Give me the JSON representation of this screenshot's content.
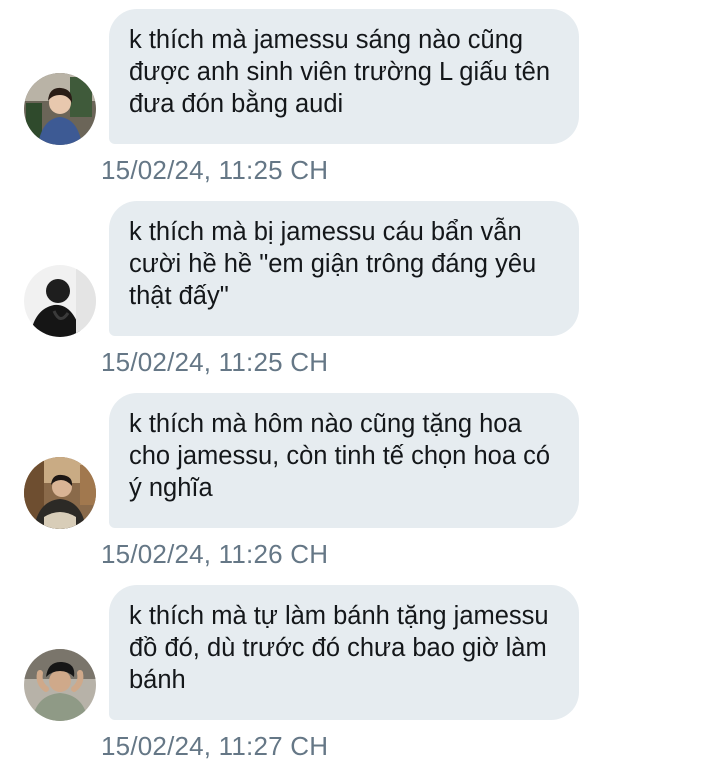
{
  "messages": [
    {
      "text": "k thích mà jamessu sáng nào cũng được anh sinh viên trường L giấu tên đưa đón bằng audi",
      "time": "15/02/24, 11:25 CH"
    },
    {
      "text": "k thích mà bị jamessu cáu bẩn vẫn cười hề hề \"em giận trông đáng yêu thật đấy\"",
      "time": "15/02/24, 11:25 CH"
    },
    {
      "text": "k thích mà hôm nào cũng tặng hoa cho jamessu, còn tinh tế chọn hoa có ý nghĩa",
      "time": "15/02/24, 11:26 CH"
    },
    {
      "text": "k thích mà tự làm bánh tặng jamessu đồ đó, dù trước đó chưa bao giờ làm bánh",
      "time": "15/02/24, 11:27 CH"
    }
  ],
  "colors": {
    "bubble": "#e6ecf0",
    "text": "#14171a",
    "timestamp": "#657786"
  }
}
